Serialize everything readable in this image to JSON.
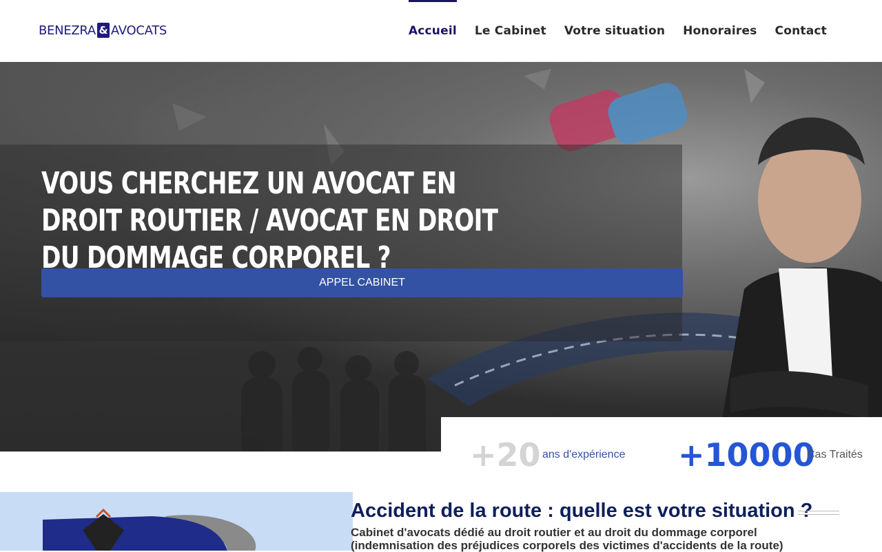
{
  "header": {
    "logo_left": "BENEZRA",
    "logo_mark": "&",
    "logo_right": "AVOCATS",
    "nav": [
      {
        "label": "Accueil",
        "active": true
      },
      {
        "label": "Le Cabinet",
        "active": false
      },
      {
        "label": "Votre situation",
        "active": false
      },
      {
        "label": "Honoraires",
        "active": false
      },
      {
        "label": "Contact",
        "active": false
      }
    ]
  },
  "hero": {
    "title": "Vous cherchez un avocat en droit routier / avocat en droit du dommage corporel ?",
    "button_label": "APPEL CABINET"
  },
  "stats": {
    "experience_value": "+20",
    "experience_label": "ans d'expérience",
    "cases_value": "+10000",
    "cases_label": "Cas Traités"
  },
  "section": {
    "title_bold1": "Accident de la route :",
    "title_normal1": " quelle est ",
    "title_bold2": "votre",
    "title_normal2": " situation ?",
    "subtitle": "Cabinet d'avocats dédié au droit routier et au droit du dommage corporel (indemnisation des préjudices corporels des victimes d'accidents de la route)"
  },
  "colors": {
    "brand": "#1a1466",
    "button": "#3352a4",
    "accent_number": "#2456d6",
    "muted_number": "#d4d4d4"
  }
}
